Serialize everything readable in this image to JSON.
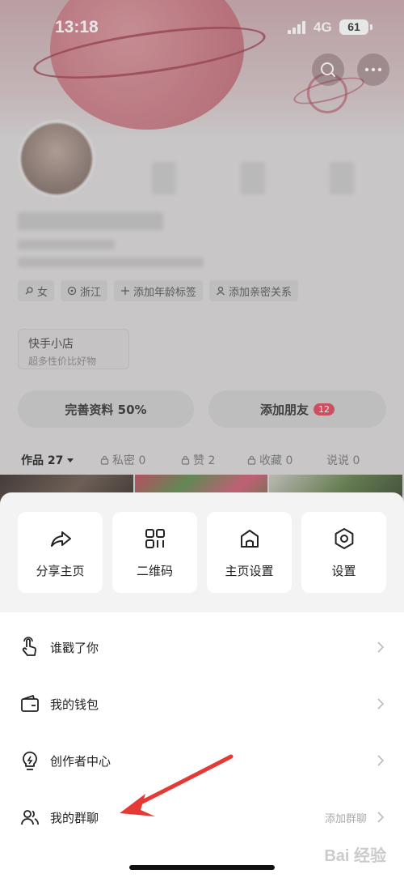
{
  "status_bar": {
    "time": "13:18",
    "network": "4G",
    "battery": "61"
  },
  "profile": {
    "tags": [
      {
        "icon": "female-icon",
        "label": "女"
      },
      {
        "icon": "location-icon",
        "label": "浙江"
      },
      {
        "icon": "plus-icon",
        "label": "添加年龄标签"
      },
      {
        "icon": "person-icon",
        "label": "添加亲密关系"
      }
    ],
    "shop": {
      "title": "快手小店",
      "subtitle": "超多性价比好物"
    },
    "complete_profile": "完善资料 50%",
    "add_friends": "添加朋友",
    "add_friends_badge": "12",
    "tabs": [
      {
        "label": "作品 27",
        "active": true
      },
      {
        "label": "私密 0",
        "locked": true
      },
      {
        "label": "赞 2",
        "locked": true
      },
      {
        "label": "收藏 0",
        "locked": true
      },
      {
        "label": "说说 0"
      }
    ]
  },
  "sheet": {
    "quick_actions": [
      {
        "icon": "share-icon",
        "label": "分享主页"
      },
      {
        "icon": "qr-code-icon",
        "label": "二维码"
      },
      {
        "icon": "home-icon",
        "label": "主页设置"
      },
      {
        "icon": "settings-icon",
        "label": "设置"
      }
    ],
    "menu": [
      {
        "icon": "tap-hand-icon",
        "label": "谁戳了你",
        "sub": ""
      },
      {
        "icon": "wallet-icon",
        "label": "我的钱包",
        "sub": ""
      },
      {
        "icon": "lightbulb-icon",
        "label": "创作者中心",
        "sub": ""
      },
      {
        "icon": "group-icon",
        "label": "我的群聊",
        "sub": "添加群聊"
      }
    ]
  },
  "colors": {
    "accent_red": "#e0475b",
    "annotation_arrow": "#e53935"
  },
  "watermark": "Bai 经验"
}
